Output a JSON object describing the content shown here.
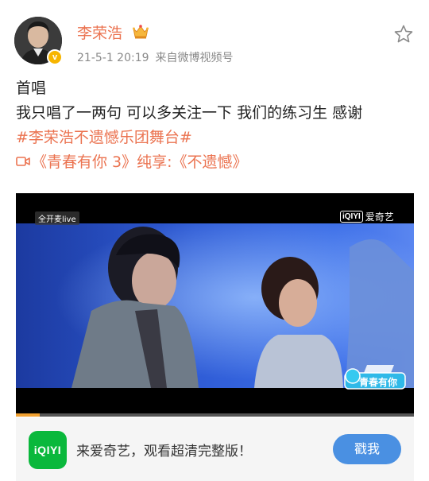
{
  "user": {
    "name": "李荣浩",
    "verified_badge": "v",
    "date": "21-5-1 20:19",
    "source": "来自微博视频号"
  },
  "post": {
    "line1": "首唱",
    "line2": "我只唱了一两句 可以多关注一下 我们的练习生 感谢",
    "hashtag": "#李荣浩不遗憾乐团舞台#",
    "video_link": "《青春有你 3》纯享:《不遗憾》"
  },
  "video": {
    "live_tag": "全开麦live",
    "watermark_box": "iQIYI",
    "watermark_text": "爱奇艺",
    "show_logo_small": "青春有你",
    "show_logo": "青春有你",
    "progress": 0.06
  },
  "ad": {
    "icon_text": "iQIYI",
    "text": "来爱奇艺，观看超清完整版！",
    "button": "戳我"
  },
  "colors": {
    "accent": "#eb7350",
    "button": "#4a90e2",
    "iqiyi_green": "#0ab83c"
  }
}
